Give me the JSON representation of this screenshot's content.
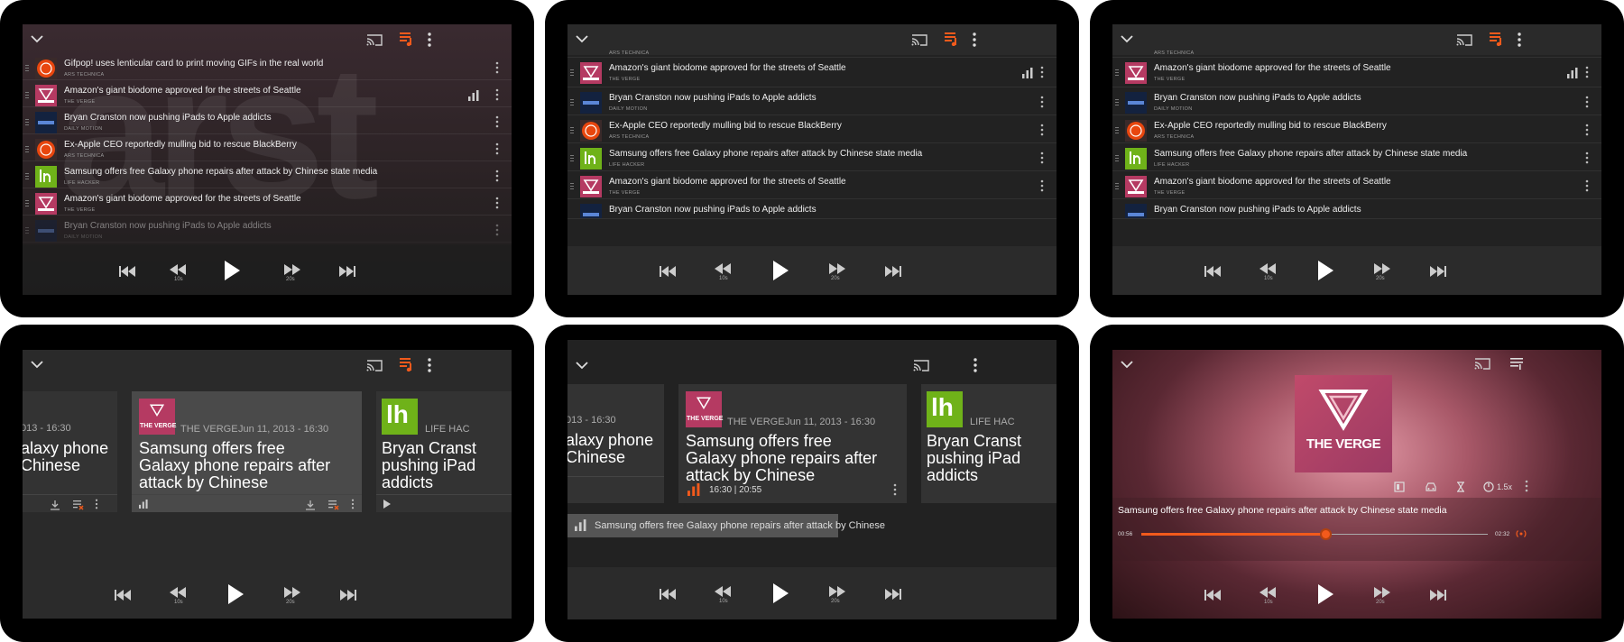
{
  "colors": {
    "accent": "#f25a1c",
    "verge": "#b53a62",
    "ars": "#e8460e",
    "dailymotion": "#13223f",
    "lifehacker": "#6fb219"
  },
  "icons": {
    "collapse": "chevron-down-icon",
    "cast": "cast-icon",
    "queue": "queue-icon",
    "more": "more-vert-icon",
    "drag": "drag-handle-icon",
    "playing": "equalizer-icon",
    "prev": "skip-previous-icon",
    "rewind": "rewind-icon",
    "play": "play-icon",
    "forward": "fast-forward-icon",
    "next": "skip-next-icon",
    "download": "download-icon",
    "remove": "remove-from-queue-icon",
    "chapters": "chapters-icon",
    "car": "car-icon",
    "sleep": "hourglass-icon",
    "speed": "speed-icon",
    "broadcast": "live-icon"
  },
  "player": {
    "rewind_label": "10s",
    "forward_label": "20s"
  },
  "player_alt": {
    "rewind_label": "10s",
    "forward_label": "20s"
  },
  "panel1": {
    "watermark": "arst",
    "items": [
      {
        "title": "Gifpop! uses lenticular card to print moving GIFs in the real world",
        "source": "ARS TECHNICA"
      },
      {
        "title": "Amazon's giant biodome approved for the streets of Seattle",
        "source": "THE VERGE"
      },
      {
        "title": "Bryan Cranston now pushing iPads to Apple addicts",
        "source": "DAILY MOTION"
      },
      {
        "title": "Ex-Apple CEO reportedly mulling bid to rescue BlackBerry",
        "source": "ARS TECHNICA"
      },
      {
        "title": "Samsung offers free Galaxy phone repairs after attack by Chinese state media",
        "source": "LIFE HACKER"
      },
      {
        "title": "Amazon's giant biodome approved for the streets of Seattle",
        "source": "THE VERGE"
      },
      {
        "title": "Bryan Cranston now pushing iPads to Apple addicts",
        "source": "DAILY MOTION"
      }
    ]
  },
  "panel2": {
    "top_source": "ARS TECHNICA",
    "items": [
      {
        "title": "Amazon's giant biodome approved for the streets of Seattle",
        "source": "THE VERGE"
      },
      {
        "title": "Bryan Cranston now pushing iPads to Apple addicts",
        "source": "DAILY MOTION"
      },
      {
        "title": "Ex-Apple CEO reportedly mulling bid to rescue BlackBerry",
        "source": "ARS TECHNICA"
      },
      {
        "title": "Samsung offers free Galaxy phone repairs after attack by Chinese state media",
        "source": "LIFE HACKER"
      },
      {
        "title": "Amazon's giant biodome approved for the streets of Seattle",
        "source": "THE VERGE"
      },
      {
        "title": "Bryan Cranston now pushing iPads to Apple addicts",
        "source": ""
      }
    ]
  },
  "panel4": {
    "left_card": {
      "date": "013 - 16:30",
      "title": "alaxy phone\nChinese"
    },
    "center_card": {
      "logo": "THE VERGE",
      "source": "THE VERGE",
      "date": "Jun 11, 2013 - 16:30",
      "title": "Samsung offers free Galaxy phone repairs after attack by Chinese"
    },
    "right_card": {
      "logo": "lh",
      "source": "LIFE HAC",
      "title": "Bryan Cranst\npushing iPad\naddicts"
    }
  },
  "panel5": {
    "left_card": {
      "date": "013 - 16:30",
      "title": "alaxy phone\nChinese"
    },
    "center_card": {
      "logo": "THE VERGE",
      "source": "THE VERGE",
      "date": "Jun 11, 2013 - 16:30",
      "title": "Samsung offers free Galaxy phone repairs after attack by Chinese",
      "progress": "16:30 | 20:55"
    },
    "right_card": {
      "logo": "lh",
      "source": "LIFE HAC",
      "title": "Bryan Cranst\npushing iPad\naddicts"
    },
    "toast": "Samsung offers free Galaxy phone repairs after attack by Chinese"
  },
  "panel6": {
    "art_logo": "THE VERGE",
    "title": "Samsung offers free Galaxy phone repairs after attack by Chinese state media",
    "elapsed": "00:56",
    "duration": "02:32",
    "progress": 0.53,
    "speed": "1.5x"
  }
}
